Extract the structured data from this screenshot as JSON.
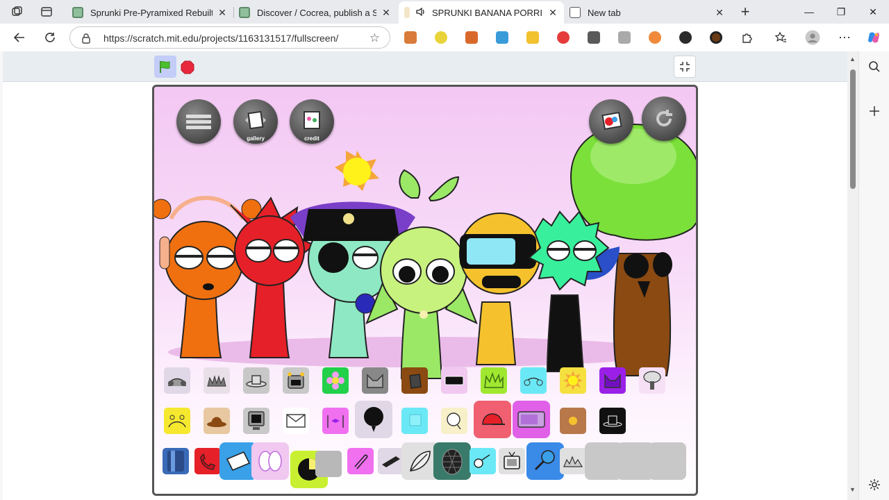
{
  "browser": {
    "tabs": [
      {
        "title": "Sprunki Pre-Pyramixed Rebuilt by",
        "close": "✕"
      },
      {
        "title": "Discover / Cocrea, publish a Scrat",
        "close": "✕"
      },
      {
        "title": "SPRUNKI BANANA PORRIDG",
        "close": "✕"
      },
      {
        "title": "New tab",
        "close": "✕"
      }
    ],
    "new_tab": "+",
    "window": {
      "minimize": "—",
      "maximize": "❐",
      "close": "✕"
    },
    "url": "https://scratch.mit.edu/projects/1163131517/fullscreen/",
    "more": "⋯"
  },
  "player": {
    "top_buttons": [
      "gallery",
      "credit"
    ]
  },
  "colors": {
    "tab_strip": "#e9eaed",
    "stage_header": "#e8edf1",
    "flag_bg": "#c3cdf7",
    "stop": "#e8283c",
    "stage_bg": "#f3c8f3"
  }
}
